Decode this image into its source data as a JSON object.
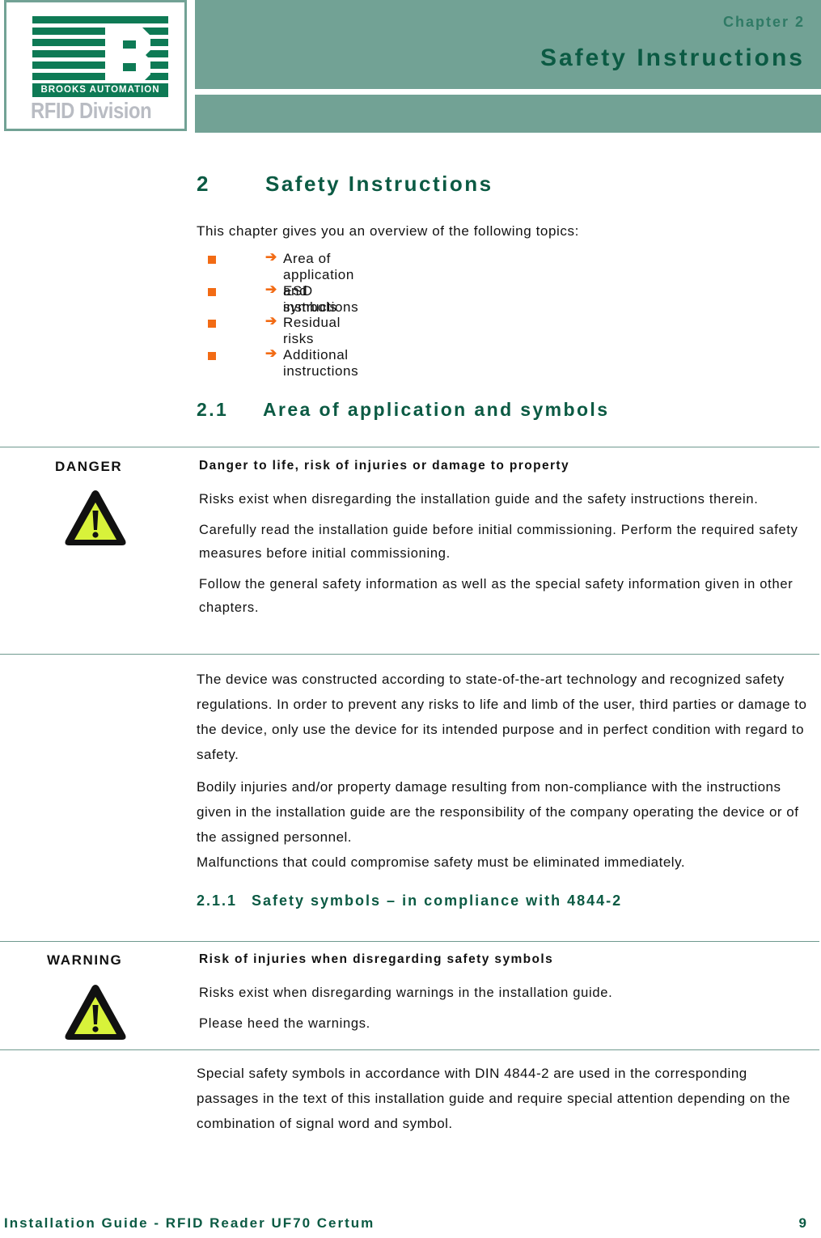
{
  "header": {
    "logo": {
      "company": "BROOKS AUTOMATION",
      "division": "RFID Division"
    },
    "chapter_label": "Chapter 2",
    "chapter_title": "Safety Instructions",
    "band_color": "#72a295",
    "heading_color": "#0b5a43"
  },
  "section": {
    "number": "2",
    "title": "Safety Instructions",
    "intro": "This chapter gives you an overview of the following topics:",
    "topics": [
      {
        "bullet_icon": "orange-square",
        "arrow_icon": "right-arrow",
        "label": "Area of application and symbols"
      },
      {
        "bullet_icon": "orange-square",
        "arrow_icon": "right-arrow",
        "label": "ESD instructions"
      },
      {
        "bullet_icon": "orange-square",
        "arrow_icon": "right-arrow",
        "label": "Residual risks"
      },
      {
        "bullet_icon": "orange-square",
        "arrow_icon": "right-arrow",
        "label": "Additional instructions"
      }
    ],
    "accent_color": "#f26b14"
  },
  "subsection": {
    "number": "2.1",
    "title": "Area of application and symbols"
  },
  "danger_box": {
    "signal_word": "DANGER",
    "icon": "warning-triangle-icon",
    "title": "Danger to life, risk of injuries or damage to property",
    "paragraphs": [
      "Risks exist when disregarding the installation guide and the safety instructions therein.",
      "Carefully read the installation guide before initial commissioning. Perform the required safety measures before initial commissioning.",
      "Follow the general safety information as well as the special safety information given in other chapters."
    ]
  },
  "area_paragraphs": [
    "The device was constructed according to state-of-the-art technology and recognized safety regulations. In order to prevent any risks to life and limb of the user, third parties or damage to the device, only use the device for its intended purpose and in perfect condition with regard to safety.",
    "Bodily injuries and/or property damage resulting from non-compliance with the instructions given in the installation guide are the responsibility of the company operating the device or of the assigned personnel.",
    "Malfunctions that could compromise safety must be eliminated immediately."
  ],
  "subsubsection": {
    "number": "2.1.1",
    "title": "Safety symbols – in compliance with 4844-2"
  },
  "warning_box": {
    "signal_word": "WARNING",
    "icon": "warning-triangle-icon",
    "title": "Risk of injuries when disregarding safety symbols",
    "paragraphs": [
      "Risks exist when disregarding warnings in the installation guide.",
      "Please heed the warnings."
    ]
  },
  "symbols_paragraph": "Special safety symbols in accordance with DIN 4844-2 are used in the corresponding passages in the text of this installation guide and require special attention depending on the combination of signal word and symbol.",
  "footer": {
    "doc_title": "Installation Guide - RFID Reader UF70 Certum",
    "page_number": "9"
  }
}
